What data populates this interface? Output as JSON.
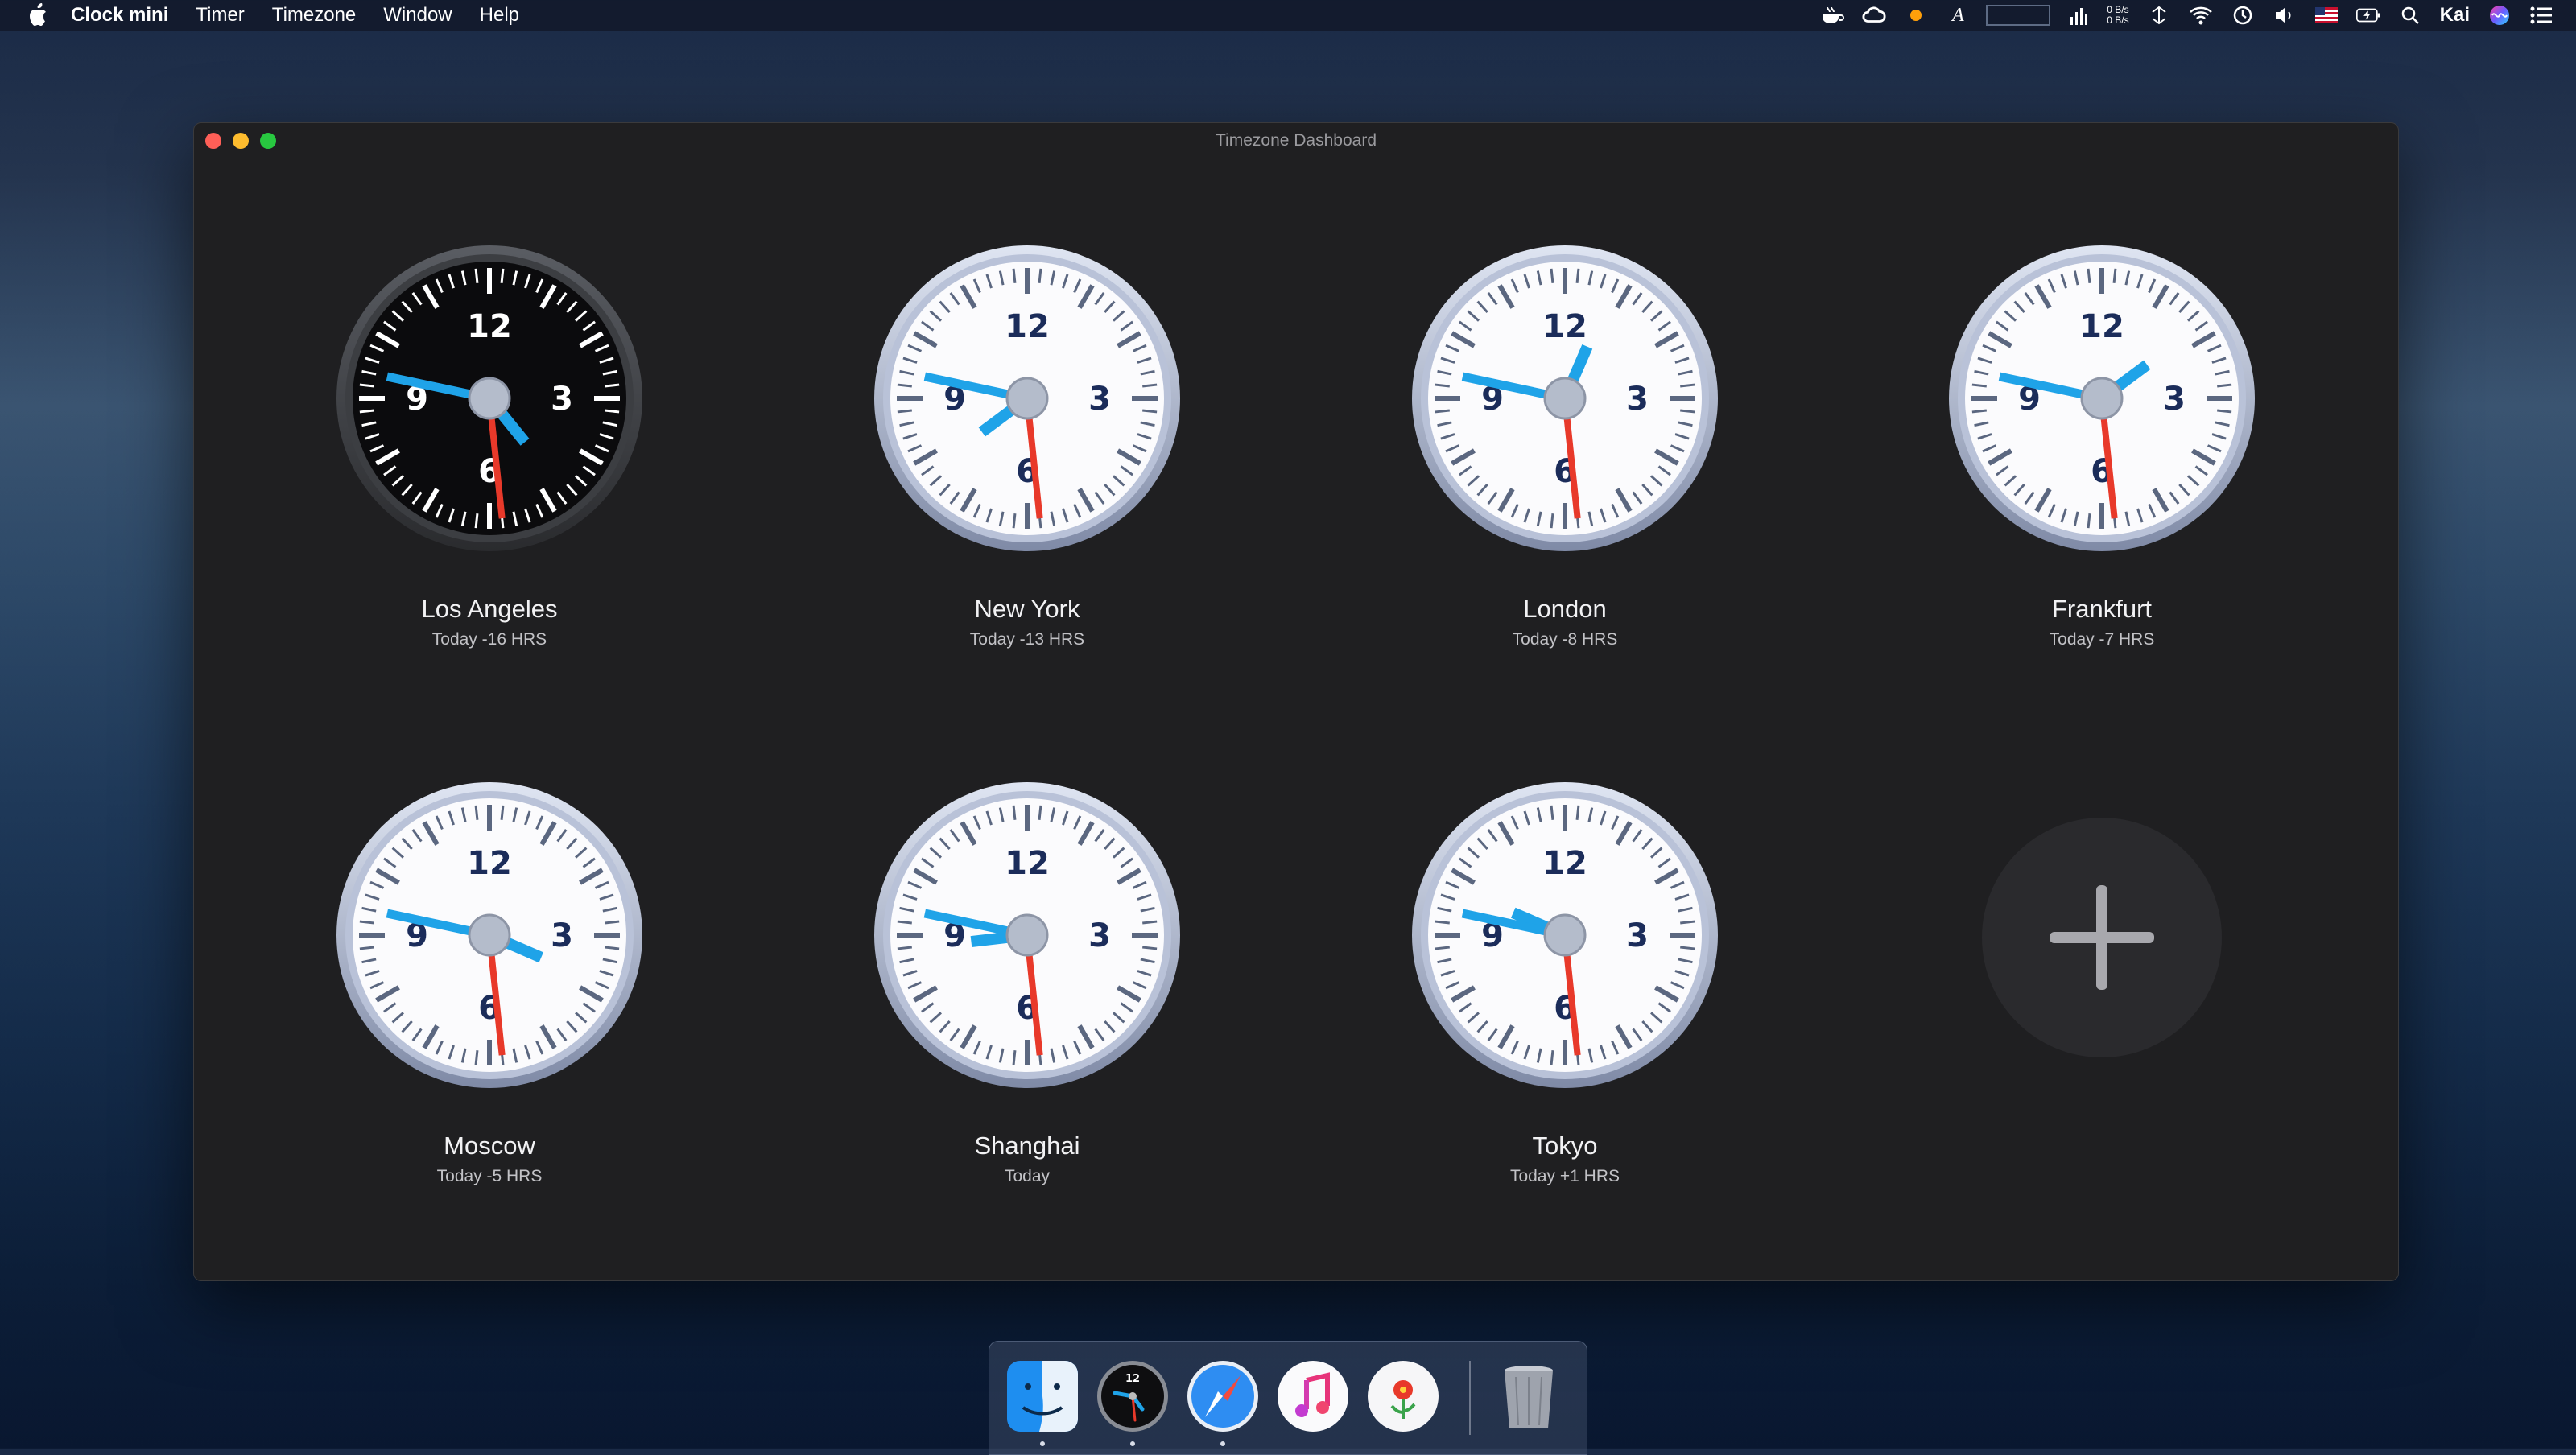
{
  "menubar": {
    "app_name": "Clock mini",
    "menus": [
      "Timer",
      "Timezone",
      "Window",
      "Help"
    ],
    "net_up": "0 B/s",
    "net_down": "0 B/s",
    "user": "Kai",
    "icons": [
      "apple-icon",
      "coffee-cup-icon",
      "creative-cloud-icon",
      "status-dot-icon",
      "text-input-a-icon",
      "audio-levels-icon",
      "network-arrows-icon",
      "wifi-icon",
      "time-machine-icon",
      "volume-icon",
      "us-flag-icon",
      "battery-icon",
      "search-icon",
      "siri-icon",
      "notification-list-icon"
    ],
    "status_dot_color": "#ff9f0a"
  },
  "window": {
    "title": "Timezone Dashboard"
  },
  "clocks": [
    {
      "city": "Los Angeles",
      "offset": "Today -16 HRS",
      "style": "dark",
      "hour": 4.7,
      "minute": 47,
      "second": 29
    },
    {
      "city": "New York",
      "offset": "Today -13 HRS",
      "style": "light",
      "hour": 7.78,
      "minute": 47,
      "second": 29
    },
    {
      "city": "London",
      "offset": "Today -8 HRS",
      "style": "light",
      "hour": 0.78,
      "minute": 47,
      "second": 29
    },
    {
      "city": "Frankfurt",
      "offset": "Today -7 HRS",
      "style": "light",
      "hour": 1.78,
      "minute": 47,
      "second": 29
    },
    {
      "city": "Moscow",
      "offset": "Today -5 HRS",
      "style": "light",
      "hour": 3.78,
      "minute": 47,
      "second": 29
    },
    {
      "city": "Shanghai",
      "offset": "Today",
      "style": "light",
      "hour": 8.78,
      "minute": 47,
      "second": 29
    },
    {
      "city": "Tokyo",
      "offset": "Today +1 HRS",
      "style": "light",
      "hour": 9.78,
      "minute": 47,
      "second": 29
    }
  ],
  "add_button": {
    "icon": "plus-icon"
  },
  "dock": {
    "items": [
      {
        "name": "finder-icon",
        "running": true
      },
      {
        "name": "clock-mini-icon",
        "running": true
      },
      {
        "name": "safari-icon",
        "running": true
      },
      {
        "name": "itunes-icon",
        "running": false
      },
      {
        "name": "photos-icon",
        "running": false
      },
      {
        "name": "trash-icon",
        "running": false
      }
    ]
  },
  "colors": {
    "hour_minute_hand": "#1fa3e8",
    "second_hand": "#e8392a",
    "numeral": "#1b2c5a",
    "window_bg": "#1f1f21"
  }
}
